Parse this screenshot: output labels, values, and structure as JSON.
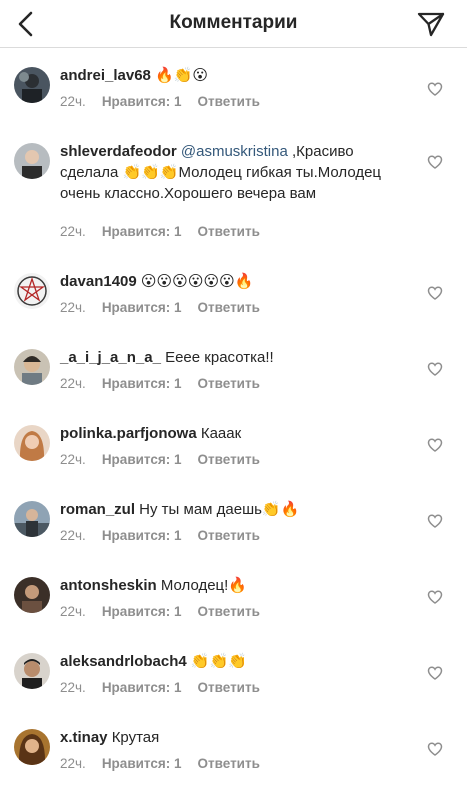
{
  "header": {
    "title": "Комментарии",
    "back_icon": "chevron-left-icon",
    "send_icon": "paper-plane-icon"
  },
  "labels": {
    "likes": "Нравится: 1",
    "reply": "Ответить"
  },
  "colors": {
    "text": "#262626",
    "secondary": "#8e8e8e",
    "mention": "#34587a",
    "divider": "#dbdbdb"
  },
  "comments": [
    {
      "username": "andrei_lav68",
      "mention": "",
      "text": " 🔥👏😮",
      "time": "22ч."
    },
    {
      "username": "shleverdafeodor",
      "mention": "@asmuskristina",
      "text": " ,Красиво сделала 👏👏👏Молодец гибкая ты.Молодец очень классно.Хорошего вечера вам",
      "time": "22ч."
    },
    {
      "username": "davan1409",
      "mention": "",
      "text": " 😮😮😮😮😮😮🔥",
      "time": "22ч."
    },
    {
      "username": "_a_i_j_a_n_a_",
      "mention": "",
      "text": " Еeee красотка!!",
      "time": "22ч."
    },
    {
      "username": "polinka.parfjonowa",
      "mention": "",
      "text": " Кааак",
      "time": "22ч."
    },
    {
      "username": "roman_zul",
      "mention": "",
      "text": " Ну ты мам даешь👏🔥",
      "time": "22ч."
    },
    {
      "username": "antonsheskin",
      "mention": "",
      "text": " Молодец!🔥",
      "time": "22ч."
    },
    {
      "username": "aleksandrlobach4",
      "mention": "",
      "text": " 👏👏👏",
      "time": "22ч."
    },
    {
      "username": "x.tinay",
      "mention": "",
      "text": " Крутая",
      "time": "22ч."
    }
  ]
}
